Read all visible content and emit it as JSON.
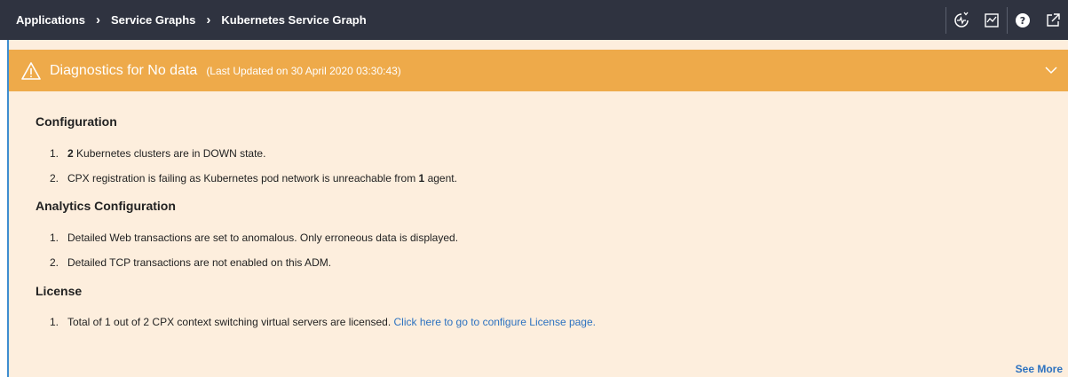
{
  "breadcrumb": {
    "items": [
      "Applications",
      "Service Graphs",
      "Kubernetes Service Graph"
    ],
    "separator": "›"
  },
  "toolbar": {
    "icons": [
      "health-check-icon",
      "analytics-icon",
      "help-icon",
      "open-external-icon"
    ]
  },
  "banner": {
    "title": "Diagnostics for No data",
    "subtitle": "(Last Updated on 30 April 2020 03:30:43)",
    "color": "#eeaa4a",
    "icon": "warning-icon"
  },
  "sections": {
    "configuration": {
      "heading": "Configuration",
      "items": [
        {
          "num": "1.",
          "bold": "2",
          "text": " Kubernetes clusters are in DOWN state."
        },
        {
          "num": "2.",
          "pre": "CPX registration is failing as Kubernetes pod network is unreachable from ",
          "bold": "1",
          "post": " agent."
        }
      ]
    },
    "analytics": {
      "heading": "Analytics Configuration",
      "items": [
        {
          "num": "1.",
          "text": "Detailed Web transactions are set to anomalous. Only erroneous data is displayed."
        },
        {
          "num": "2.",
          "text": "Detailed TCP transactions are not enabled on this ADM."
        }
      ]
    },
    "license": {
      "heading": "License",
      "items": [
        {
          "num": "1.",
          "text": "Total of 1 out of 2 CPX context switching virtual servers are licensed. ",
          "link": "Click here to go to configure License page."
        }
      ]
    }
  },
  "see_more": "See More"
}
